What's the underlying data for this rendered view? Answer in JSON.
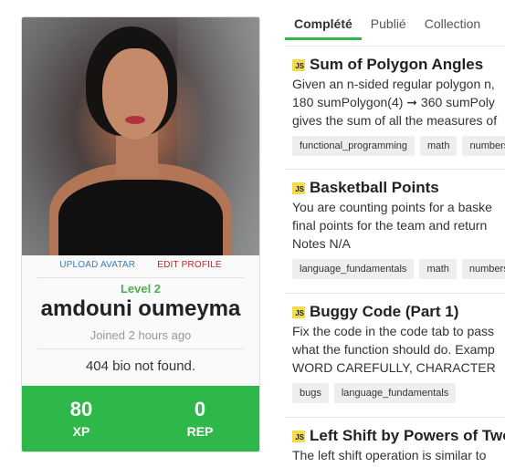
{
  "profile": {
    "upload_avatar": "UPLOAD AVATAR",
    "edit_profile": "EDIT PROFILE",
    "level": "Level 2",
    "name": "amdouni oumeyma",
    "joined": "Joined 2 hours ago",
    "bio": "404 bio not found.",
    "xp_value": "80",
    "xp_label": "XP",
    "rep_value": "0",
    "rep_label": "REP"
  },
  "tabs": [
    {
      "label": "Complété",
      "active": true
    },
    {
      "label": "Publié",
      "active": false
    },
    {
      "label": "Collection",
      "active": false
    }
  ],
  "challenges": [
    {
      "badge": "JS",
      "title": "Sum of Polygon Angles",
      "desc": [
        "Given an n-sided regular polygon n,",
        "180 sumPolygon(4) ➞ 360 sumPoly",
        "gives the sum of all the measures of"
      ],
      "tags": [
        "functional_programming",
        "math",
        "numbers"
      ]
    },
    {
      "badge": "JS",
      "title": "Basketball Points",
      "desc": [
        "You are counting points for a baske",
        "final points for the team and return",
        "Notes N/A"
      ],
      "tags": [
        "language_fundamentals",
        "math",
        "numbers"
      ]
    },
    {
      "badge": "JS",
      "title": "Buggy Code (Part 1)",
      "desc": [
        "Fix the code in the code tab to pass",
        "what the function should do. Examp",
        "WORD CAREFULLY, CHARACTER"
      ],
      "tags": [
        "bugs",
        "language_fundamentals"
      ]
    },
    {
      "badge": "JS",
      "title": "Left Shift by Powers of Two",
      "desc": [
        "The left shift operation is similar to"
      ],
      "tags": []
    }
  ],
  "colors": {
    "accent_green": "#2fb84a",
    "level_green": "#4caf50",
    "link_blue": "#3a7bbf",
    "link_red": "#c0272d",
    "js_yellow": "#f0db4f"
  }
}
